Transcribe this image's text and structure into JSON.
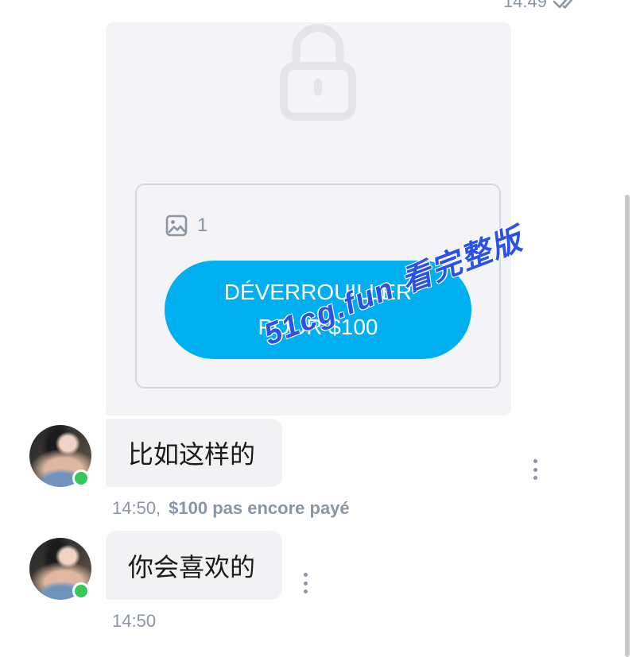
{
  "previous_message": {
    "time": "14:49",
    "status_icon": "double-check-icon"
  },
  "locked_media": {
    "lock_icon": "lock-icon",
    "media_icon": "image-icon",
    "media_count": "1",
    "unlock_label": "DÉVERROUILLER POUR $100"
  },
  "watermark": "51cg.fun 看完整版",
  "messages": [
    {
      "text": "比如这样的",
      "online": true,
      "menu_icon": "more-vertical-icon",
      "time_label": "14:50,",
      "payment_status": "$100 pas encore payé"
    },
    {
      "text": "你会喜欢的",
      "online": true,
      "menu_icon": "more-vertical-icon",
      "time_label": "14:50"
    }
  ],
  "colors": {
    "accent": "#00aff0",
    "meta_text": "#8a96a3",
    "bubble_background": "#f2f2f4",
    "card_background": "#f4f4f6",
    "online_dot": "#34c759",
    "watermark": "#2a52e6"
  }
}
